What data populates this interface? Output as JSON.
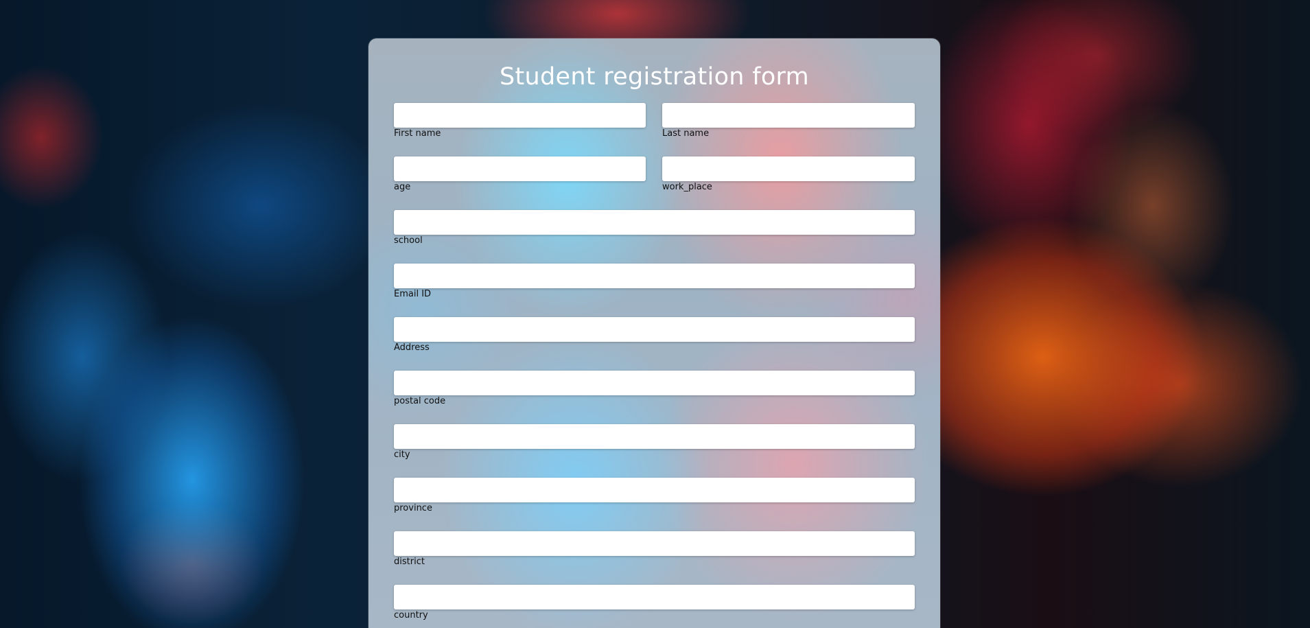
{
  "form": {
    "title": "Student registration form",
    "fields": {
      "first_name": {
        "label": "First name",
        "value": ""
      },
      "last_name": {
        "label": "Last name",
        "value": ""
      },
      "age": {
        "label": "age",
        "value": ""
      },
      "work_place": {
        "label": "work_place",
        "value": ""
      },
      "school": {
        "label": "school",
        "value": ""
      },
      "email": {
        "label": "Email ID",
        "value": ""
      },
      "address": {
        "label": "Address",
        "value": ""
      },
      "postal_code": {
        "label": "postal code",
        "value": ""
      },
      "city": {
        "label": "city",
        "value": ""
      },
      "province": {
        "label": "province",
        "value": ""
      },
      "district": {
        "label": "district",
        "value": ""
      },
      "country": {
        "label": "country",
        "value": ""
      }
    }
  }
}
